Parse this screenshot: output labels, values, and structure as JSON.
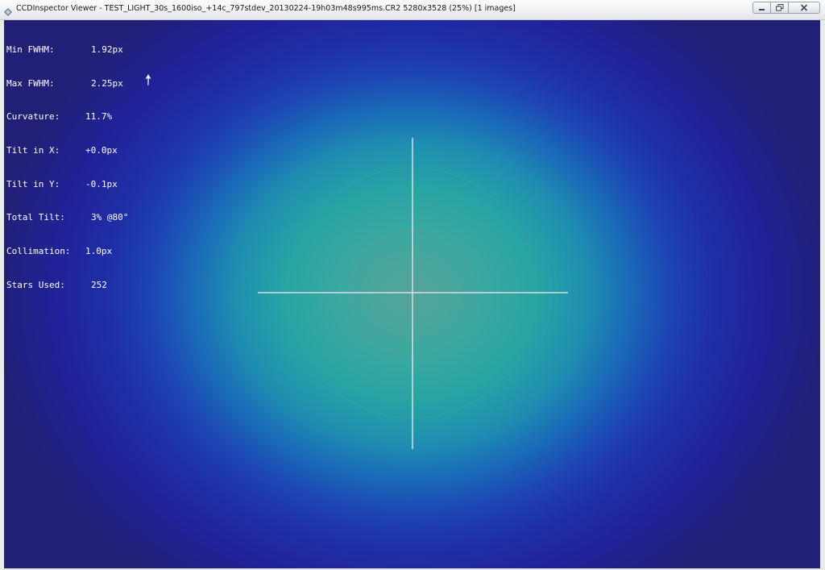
{
  "window": {
    "title": "CCDInspector Viewer - TEST_LIGHT_30s_1600iso_+14c_797stdev_20130224-19h03m48s995ms.CR2 5280x3528 (25%)  [1 images]",
    "app_icon": "ccdinspector-app-icon",
    "controls": [
      "minimize-icon",
      "restore-icon",
      "close-icon"
    ]
  },
  "stats": {
    "min_fwhm": {
      "label": "Min FWHM:",
      "value": "1.92px"
    },
    "max_fwhm": {
      "label": "Max FWHM:",
      "value": "2.25px"
    },
    "curvature": {
      "label": "Curvature:",
      "value": "11.7%"
    },
    "tilt_x": {
      "label": "Tilt in X:",
      "value": "+0.0px"
    },
    "tilt_y": {
      "label": "Tilt in Y:",
      "value": "-0.1px"
    },
    "total_tilt": {
      "label": "Total Tilt:",
      "value": "3% @80°"
    },
    "collimation": {
      "label": "Collimation:",
      "value": "1.0px"
    },
    "stars_used": {
      "label": "Stars Used:",
      "value": "252"
    }
  },
  "tilt_direction_icon": "arrow-up-icon",
  "colors": {
    "center": "#57a39a",
    "mid": "#1a6bb8",
    "edge": "#221f76",
    "crosshair": "#d8dde2"
  }
}
